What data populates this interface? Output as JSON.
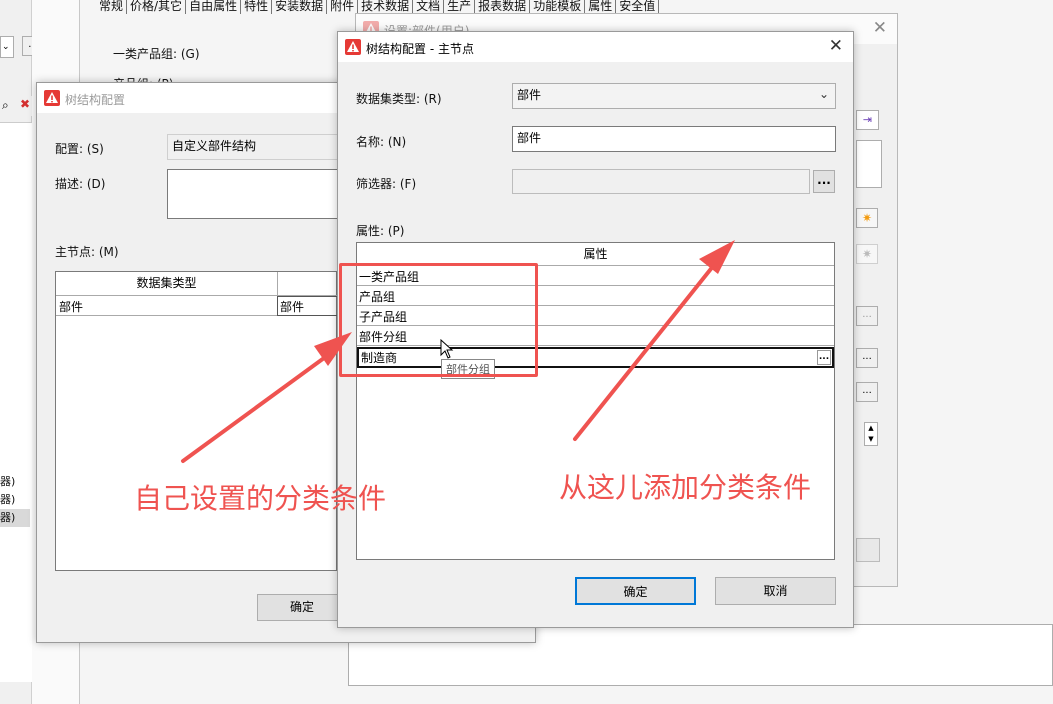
{
  "background_app": {
    "tabs": [
      "常规",
      "价格/其它",
      "自由属性",
      "特性",
      "安装数据",
      "附件",
      "技术数据",
      "文档",
      "生产",
      "报表数据",
      "功能模板",
      "属性",
      "安全值"
    ],
    "product_group_label": "一类产品组: (G)",
    "product_group_2_label": "产品组: (P)",
    "list_items": [
      "器)",
      "器)",
      "器)"
    ],
    "ellipsis": "...",
    "binoculars_icon": "binoculars-icon"
  },
  "settings_window": {
    "title": "设置:部件(用户)"
  },
  "tree_config_window": {
    "title": "树结构配置",
    "config_label": "配置: (S)",
    "config_value": "自定义部件结构",
    "desc_label": "描述: (D)",
    "main_node_label": "主节点: (M)",
    "table": {
      "headers": [
        "数据集类型",
        ""
      ],
      "rows": [
        [
          "部件",
          "部件"
        ]
      ]
    },
    "ok_label": "确定"
  },
  "main_node_window": {
    "title": "树结构配置 - 主节点",
    "dataset_type_label": "数据集类型: (R)",
    "dataset_type_value": "部件",
    "name_label": "名称: (N)",
    "name_value": "部件",
    "filter_label": "筛选器: (F)",
    "filter_value": "",
    "ellipsis": "...",
    "properties_label": "属性: (P)",
    "properties_header": "属性",
    "properties": [
      "一类产品组",
      "产品组",
      "子产品组",
      "部件分组",
      "制造商"
    ],
    "tooltip": "部件分组",
    "ok_label": "确定",
    "cancel_label": "取消"
  },
  "annotations": {
    "left_text": "自己设置的分类条件",
    "right_text": "从这儿添加分类条件"
  },
  "colors": {
    "annotation_red": "#ef5350",
    "warn_red": "#e53935",
    "toolbar_add": "#f39c12",
    "toolbar_delete": "#d32f2f",
    "toolbar_arrow": "#1e6bc4"
  }
}
